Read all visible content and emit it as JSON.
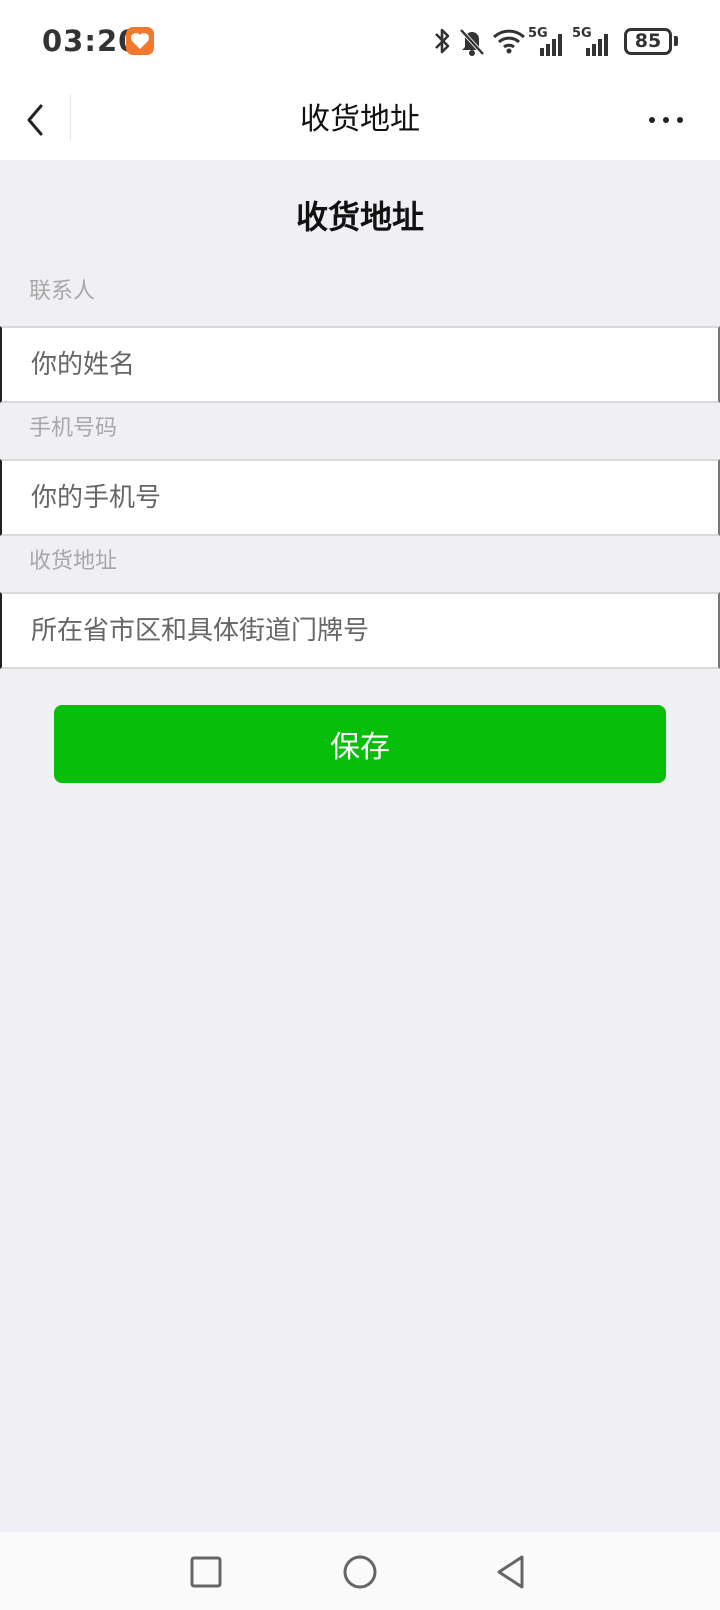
{
  "status_bar": {
    "time": "03:20",
    "battery": "85",
    "network_1": "5G",
    "network_2": "5G"
  },
  "nav": {
    "title": "收货地址",
    "back_icon": "chevron-left-icon",
    "more_icon": "more-horizontal-icon"
  },
  "form": {
    "heading": "收货地址",
    "fields": [
      {
        "label": "联系人",
        "placeholder": "你的姓名",
        "value": ""
      },
      {
        "label": "手机号码",
        "placeholder": "你的手机号",
        "value": ""
      },
      {
        "label": "收货地址",
        "placeholder": "所在省市区和具体街道门牌号",
        "value": ""
      }
    ],
    "save_label": "保存"
  },
  "colors": {
    "accent": "#07be0b",
    "background": "#efeff4"
  }
}
